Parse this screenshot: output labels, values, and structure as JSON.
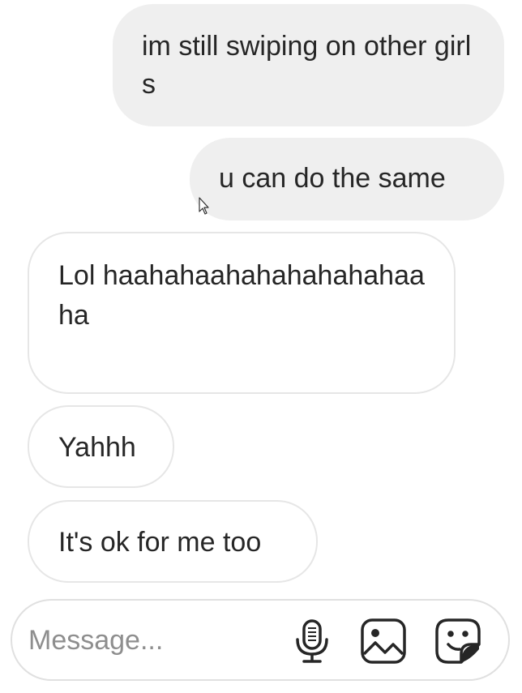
{
  "messages": [
    {
      "id": "m1",
      "direction": "sent",
      "text": "im still swiping on other girls"
    },
    {
      "id": "m2",
      "direction": "sent",
      "text": "u can do the same"
    },
    {
      "id": "m3",
      "direction": "received",
      "text": "Lol haahahaahahahahahahaaha"
    },
    {
      "id": "m4",
      "direction": "received",
      "text": "Yahhh"
    },
    {
      "id": "m5",
      "direction": "received",
      "text": "It's ok for me too"
    }
  ],
  "composer": {
    "placeholder": "Message...",
    "value": "",
    "icons": [
      "microphone-icon",
      "image-icon",
      "sticker-icon"
    ]
  },
  "colors": {
    "sent_bubble": "#efefef",
    "received_border": "#e6e6e6",
    "text": "#262626",
    "placeholder": "#8e8e8e"
  }
}
